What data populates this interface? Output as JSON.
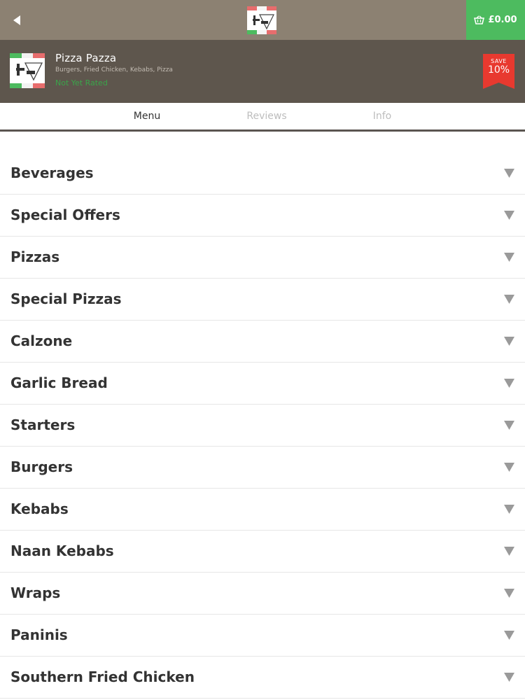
{
  "header": {
    "back_icon": "back-arrow-icon",
    "logo_icon": "pizza-pazza-logo-icon",
    "basket_total": "£0.00",
    "basket_icon": "basket-icon",
    "basket_color": "#4dbb5f"
  },
  "restaurant": {
    "name": "Pizza Pazza",
    "cuisines": "Burgers, Fried Chicken, Kebabs, Pizza",
    "rating_status": "Not Yet Rated",
    "discount": {
      "label": "SAVE",
      "value": "10%",
      "color": "#e8392f"
    }
  },
  "tabs": [
    {
      "label": "Menu",
      "active": true
    },
    {
      "label": "Reviews",
      "active": false
    },
    {
      "label": "Info",
      "active": false
    }
  ],
  "categories": [
    "Beverages",
    "Special Offers",
    "Pizzas",
    "Special Pizzas",
    "Calzone",
    "Garlic Bread",
    "Starters",
    "Burgers",
    "Kebabs",
    "Naan Kebabs",
    "Wraps",
    "Paninis",
    "Southern Fried Chicken"
  ],
  "colors": {
    "topbar": "#8c8172",
    "infobar": "#5e564d",
    "rating": "#3aa54a"
  }
}
